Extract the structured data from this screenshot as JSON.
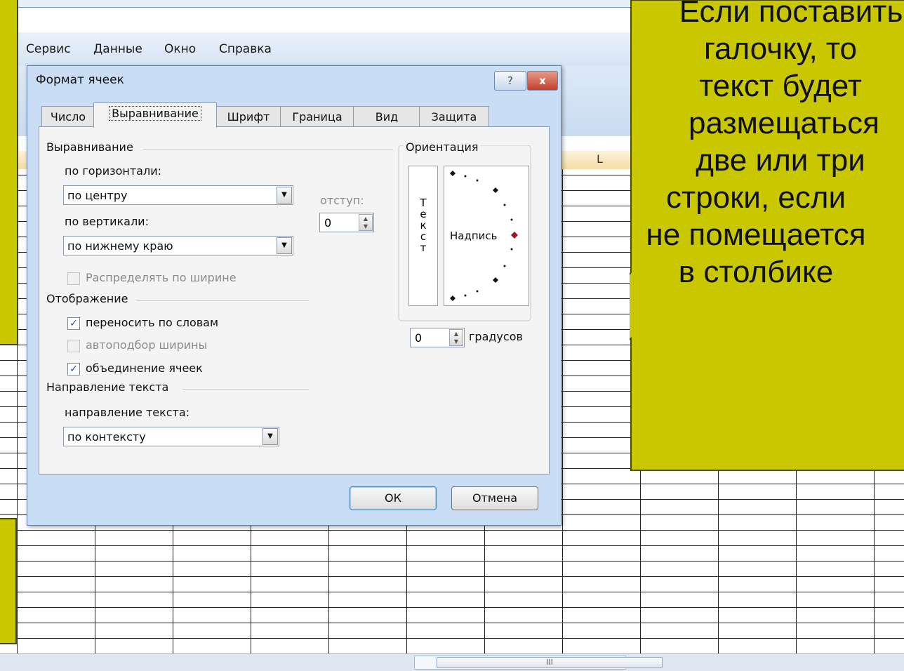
{
  "menu": {
    "items": [
      "Сервис",
      "Данные",
      "Окно",
      "Справка"
    ]
  },
  "excel": {
    "column_letter": "L",
    "scroll_glyph": "III"
  },
  "dialog": {
    "title": "Формат ячеек",
    "help_glyph": "?",
    "close_glyph": "x",
    "tabs": [
      "Число",
      "Выравнивание",
      "Шрифт",
      "Граница",
      "Вид",
      "Защита"
    ],
    "alignment": {
      "group": "Выравнивание",
      "horizontal_label": "по горизонтали:",
      "horizontal_value": "по центру",
      "indent_label": "отступ:",
      "indent_value": "0",
      "vertical_label": "по вертикали:",
      "vertical_value": "по нижнему краю",
      "distribute_label": "Распределять по ширине"
    },
    "display": {
      "group": "Отображение",
      "wrap_label": "переносить по словам",
      "wrap_checked": true,
      "shrink_label": "автоподбор ширины",
      "shrink_checked": false,
      "merge_label": "объединение ячеек",
      "merge_checked": true
    },
    "direction": {
      "group": "Направление текста",
      "label": "направление текста:",
      "value": "по контексту"
    },
    "orientation": {
      "group": "Ориентация",
      "vertical_text": [
        "Т",
        "е",
        "к",
        "с",
        "т"
      ],
      "arc_label": "Надпись",
      "degrees_value": "0",
      "degrees_label": "градусов"
    },
    "ok_label": "ОК",
    "cancel_label": "Отмена"
  },
  "callout": {
    "lines": [
      "Если поставить",
      "галочку, то",
      "текст будет",
      "размещаться",
      "две или три",
      "строки, если",
      "не помещается",
      "в столбике"
    ]
  },
  "colors": {
    "callout_fill": "#c9c800",
    "dialog_frame": "#c9ddf4",
    "close_red": "#c2402c"
  }
}
